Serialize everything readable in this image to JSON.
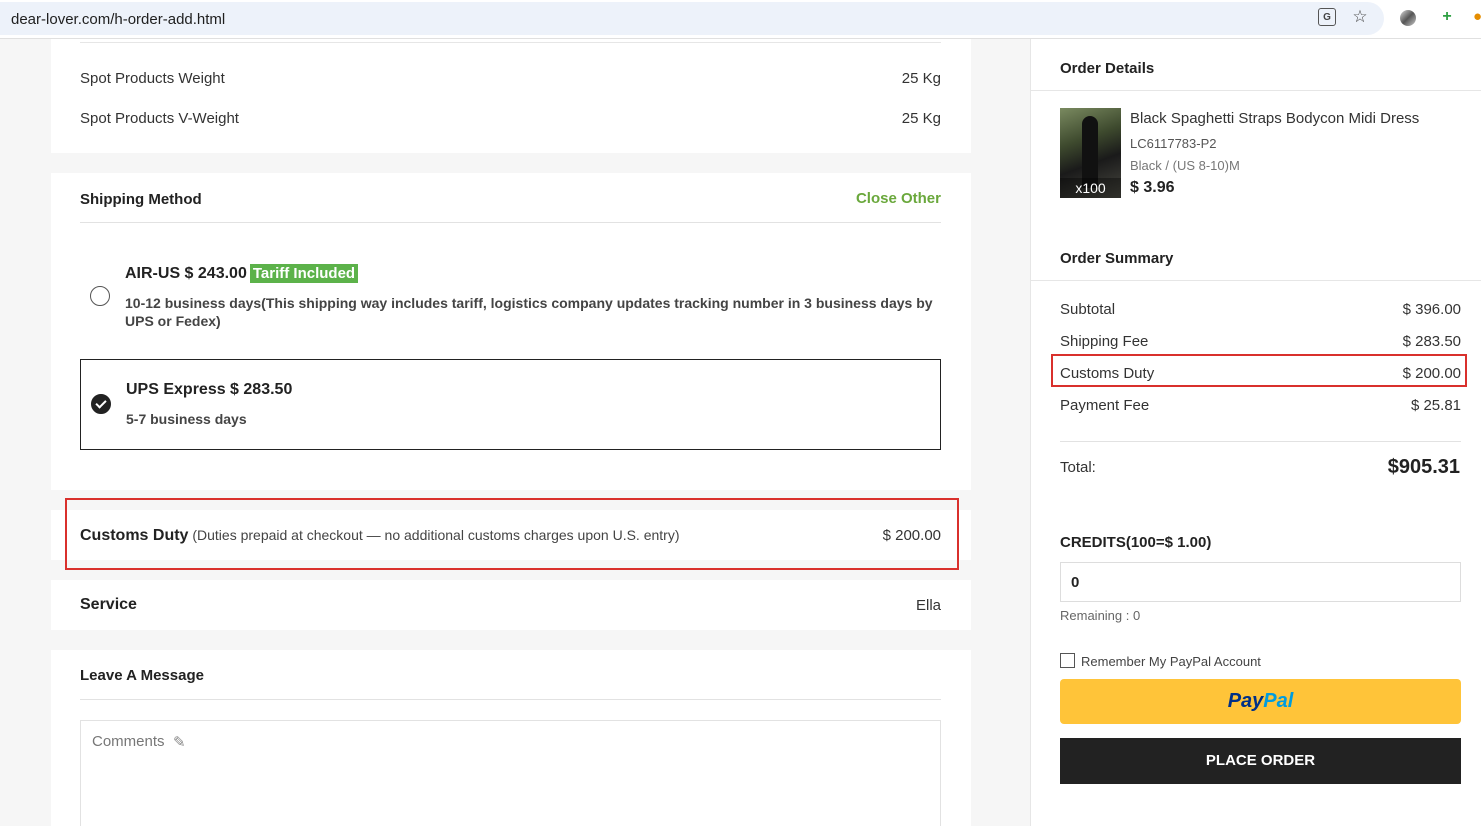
{
  "browser": {
    "url": "dear-lover.com/h-order-add.html"
  },
  "weights": [
    {
      "label": "Spot Products Weight",
      "value": "25 Kg"
    },
    {
      "label": "Spot Products V-Weight",
      "value": "25 Kg"
    }
  ],
  "shipping": {
    "title": "Shipping Method",
    "close_other": "Close Other",
    "options": [
      {
        "name": "AIR-US $ 243.00",
        "badge": "Tariff Included",
        "desc": "10-12 business days(This shipping way includes tariff, logistics company updates tracking number in 3 business days by UPS or Fedex)",
        "selected": false
      },
      {
        "name": "UPS Express $ 283.50",
        "desc": "5-7 business days",
        "selected": true
      }
    ]
  },
  "duty": {
    "label": "Customs Duty",
    "note": "(Duties prepaid at checkout — no additional customs charges upon U.S. entry)",
    "value": "$ 200.00"
  },
  "service": {
    "label": "Service",
    "value": "Ella"
  },
  "message": {
    "title": "Leave A Message",
    "placeholder": "Comments"
  },
  "order_details": {
    "title": "Order Details",
    "product": {
      "name": "Black Spaghetti Straps Bodycon Midi Dress",
      "sku": "LC6117783-P2",
      "variant": "Black / (US 8-10)M",
      "price": "$ 3.96",
      "qty": "x100"
    }
  },
  "summary": {
    "title": "Order Summary",
    "rows": [
      {
        "label": "Subtotal",
        "value": "$ 396.00"
      },
      {
        "label": "Shipping Fee",
        "value": "$ 283.50"
      },
      {
        "label": "Customs Duty",
        "value": "$ 200.00"
      },
      {
        "label": "Payment Fee",
        "value": "$ 25.81"
      }
    ],
    "total_label": "Total:",
    "total_value": "$905.31"
  },
  "credits": {
    "title": "CREDITS(100=$ 1.00)",
    "value": "0",
    "remaining": "Remaining : 0"
  },
  "paypal": {
    "remember": "Remember My PayPal Account",
    "pay": "Pay",
    "pal": "Pal"
  },
  "place_order": "PLACE ORDER",
  "colors": {
    "accent_green": "#6aa83c",
    "badge_green": "#5cb24a",
    "highlight_red": "#d9302c",
    "paypal_yellow": "#ffc439"
  },
  "icons": {
    "translate": "translate-icon",
    "star": "star-icon",
    "pencil": "pencil-icon"
  }
}
